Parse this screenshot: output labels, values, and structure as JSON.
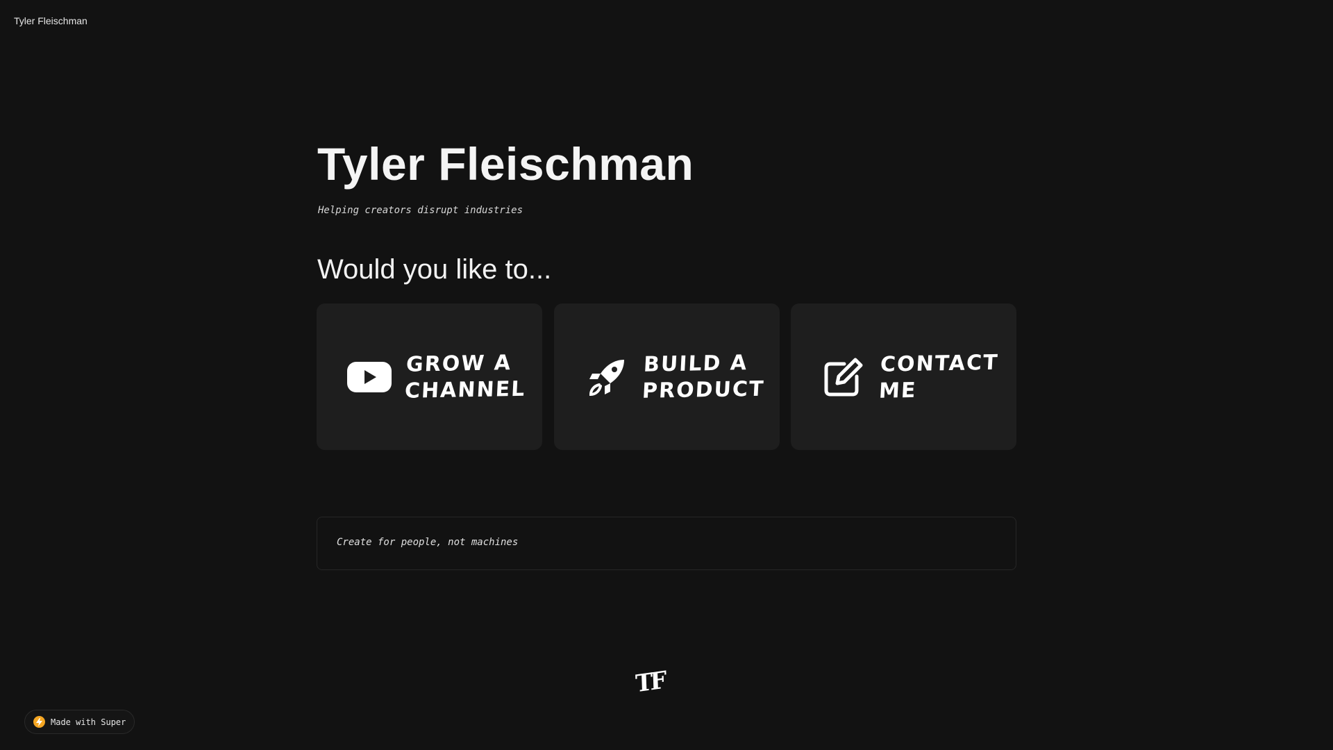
{
  "header": {
    "site_name": "Tyler Fleischman"
  },
  "hero": {
    "title": "Tyler Fleischman",
    "tagline": "Helping creators disrupt industries"
  },
  "section": {
    "heading": "Would you like to..."
  },
  "cards": [
    {
      "label": "Grow a channel",
      "icon": "youtube-play-icon"
    },
    {
      "label": "Build a product",
      "icon": "rocket-icon"
    },
    {
      "label": "Contact me",
      "icon": "edit-icon"
    }
  ],
  "quote": {
    "text": "Create for people, not machines"
  },
  "footer": {
    "logo_text": "TF",
    "badge_label": "Made with Super",
    "badge_icon": "bolt-icon",
    "badge_icon_color": "#f5a623"
  },
  "colors": {
    "background": "#121212",
    "card": "#1e1e1e",
    "text": "#f2f2f2"
  }
}
